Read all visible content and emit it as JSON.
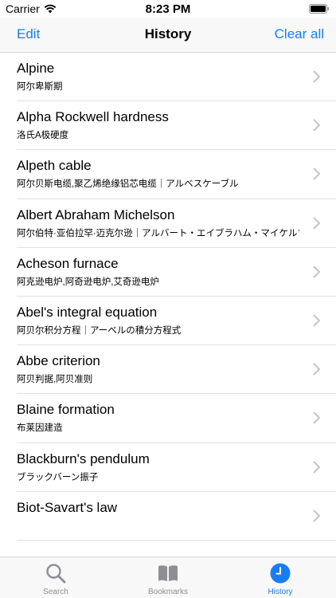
{
  "status": {
    "carrier": "Carrier",
    "time": "8:23 PM"
  },
  "nav": {
    "edit_label": "Edit",
    "title": "History",
    "clear_label": "Clear all"
  },
  "history": [
    {
      "title": "Alpine",
      "subtitle": "阿尔卑斯期"
    },
    {
      "title": "Alpha Rockwell hardness",
      "subtitle": "洛氏A极硬度"
    },
    {
      "title": "Alpeth cable",
      "subtitle": "阿尔贝斯电缆,聚乙烯绝缘铝芯电缆｜アルベスケーブル"
    },
    {
      "title": "Albert Abraham Michelson",
      "subtitle": "阿尔伯特·亚伯拉罕·迈克尔逊｜アルバート・エイブラハム・マイケルソン"
    },
    {
      "title": "Acheson furnace",
      "subtitle": "阿克逊电炉,阿奇逊电炉,艾奇逊电炉"
    },
    {
      "title": "Abel's integral equation",
      "subtitle": "阿贝尔积分方程｜アーベルの積分方程式"
    },
    {
      "title": "Abbe criterion",
      "subtitle": "阿贝判据,阿贝准则"
    },
    {
      "title": "Blaine formation",
      "subtitle": "布莱因建造"
    },
    {
      "title": "Blackburn's pendulum",
      "subtitle": "ブラックバーン振子"
    },
    {
      "title": "Biot-Savart's law",
      "subtitle": ""
    }
  ],
  "tabs": [
    {
      "label": "Search",
      "icon": "search-icon",
      "active": false
    },
    {
      "label": "Bookmarks",
      "icon": "bookmarks-icon",
      "active": false
    },
    {
      "label": "History",
      "icon": "clock-icon",
      "active": true
    }
  ],
  "colors": {
    "accent": "#1a7cf5",
    "inactive": "#8e8e93"
  }
}
